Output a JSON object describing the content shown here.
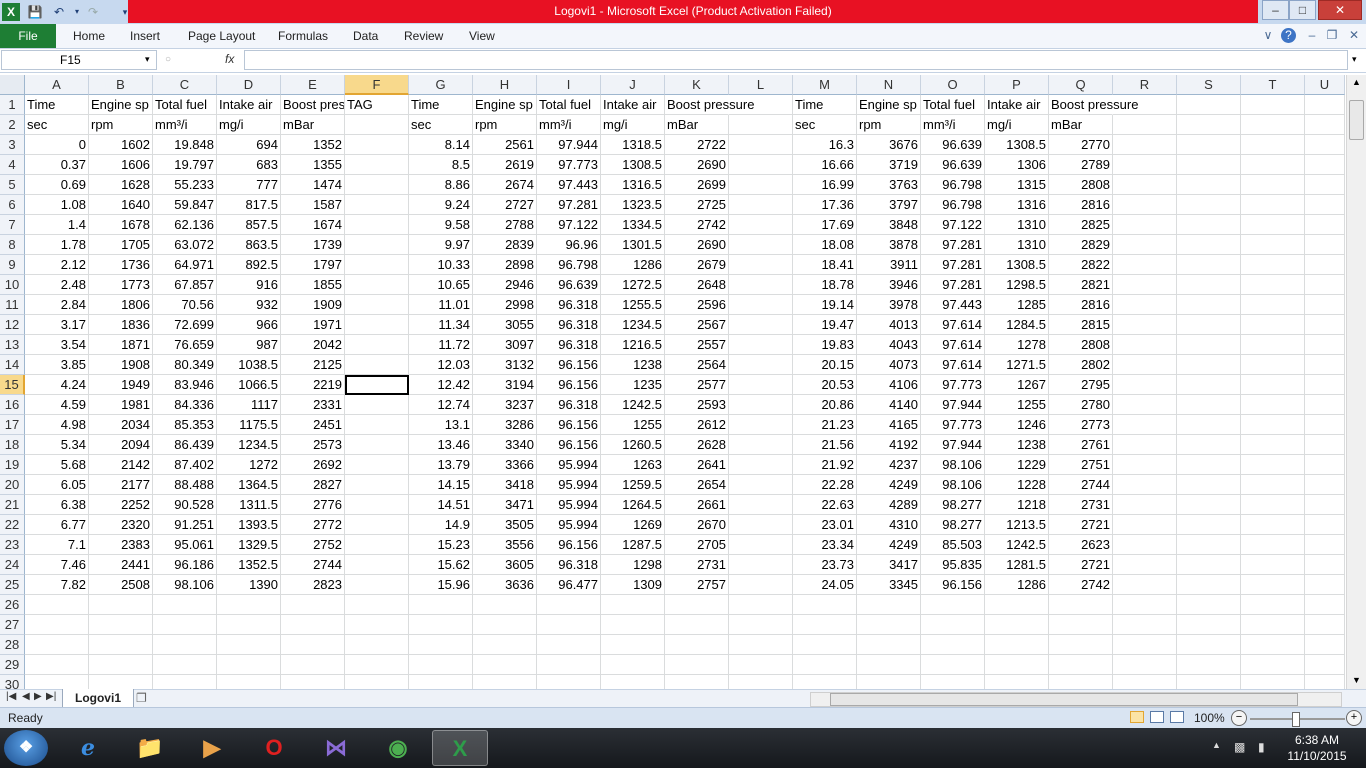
{
  "window": {
    "title": "Logovi1  -  Microsoft Excel (Product Activation Failed)",
    "minimize": "–",
    "maximize": "□",
    "close": "✕"
  },
  "ribbon": {
    "file": "File",
    "tabs": [
      "Home",
      "Insert",
      "Page Layout",
      "Formulas",
      "Data",
      "Review",
      "View"
    ]
  },
  "formula_bar": {
    "name_box": "F15",
    "fx": "fx",
    "content": ""
  },
  "grid": {
    "active_cell": "F15",
    "selected_col": "F",
    "selected_row": 15,
    "columns": [
      "A",
      "B",
      "C",
      "D",
      "E",
      "F",
      "G",
      "H",
      "I",
      "J",
      "K",
      "L",
      "M",
      "N",
      "O",
      "P",
      "Q",
      "R",
      "S",
      "T",
      "U"
    ],
    "rows": [
      [
        "Time",
        "Engine sp",
        "Total fuel",
        "Intake air",
        "Boost pres",
        "TAG",
        "Time",
        "Engine sp",
        "Total fuel",
        "Intake air",
        "Boost pressure",
        "",
        "Time",
        "Engine sp",
        "Total fuel",
        "Intake air",
        "Boost pressure",
        "",
        "",
        "",
        ""
      ],
      [
        "sec",
        "rpm",
        "mm³/i",
        "mg/i",
        "mBar",
        "",
        "sec",
        "rpm",
        "mm³/i",
        "mg/i",
        "mBar",
        "",
        "sec",
        "rpm",
        "mm³/i",
        "mg/i",
        "mBar",
        "",
        "",
        "",
        ""
      ],
      [
        "0",
        "1602",
        "19.848",
        "694",
        "1352",
        "",
        "8.14",
        "2561",
        "97.944",
        "1318.5",
        "2722",
        "",
        "16.3",
        "3676",
        "96.639",
        "1308.5",
        "2770",
        "",
        "",
        "",
        ""
      ],
      [
        "0.37",
        "1606",
        "19.797",
        "683",
        "1355",
        "",
        "8.5",
        "2619",
        "97.773",
        "1308.5",
        "2690",
        "",
        "16.66",
        "3719",
        "96.639",
        "1306",
        "2789",
        "",
        "",
        "",
        ""
      ],
      [
        "0.69",
        "1628",
        "55.233",
        "777",
        "1474",
        "",
        "8.86",
        "2674",
        "97.443",
        "1316.5",
        "2699",
        "",
        "16.99",
        "3763",
        "96.798",
        "1315",
        "2808",
        "",
        "",
        "",
        ""
      ],
      [
        "1.08",
        "1640",
        "59.847",
        "817.5",
        "1587",
        "",
        "9.24",
        "2727",
        "97.281",
        "1323.5",
        "2725",
        "",
        "17.36",
        "3797",
        "96.798",
        "1316",
        "2816",
        "",
        "",
        "",
        ""
      ],
      [
        "1.4",
        "1678",
        "62.136",
        "857.5",
        "1674",
        "",
        "9.58",
        "2788",
        "97.122",
        "1334.5",
        "2742",
        "",
        "17.69",
        "3848",
        "97.122",
        "1310",
        "2825",
        "",
        "",
        "",
        ""
      ],
      [
        "1.78",
        "1705",
        "63.072",
        "863.5",
        "1739",
        "",
        "9.97",
        "2839",
        "96.96",
        "1301.5",
        "2690",
        "",
        "18.08",
        "3878",
        "97.281",
        "1310",
        "2829",
        "",
        "",
        "",
        ""
      ],
      [
        "2.12",
        "1736",
        "64.971",
        "892.5",
        "1797",
        "",
        "10.33",
        "2898",
        "96.798",
        "1286",
        "2679",
        "",
        "18.41",
        "3911",
        "97.281",
        "1308.5",
        "2822",
        "",
        "",
        "",
        ""
      ],
      [
        "2.48",
        "1773",
        "67.857",
        "916",
        "1855",
        "",
        "10.65",
        "2946",
        "96.639",
        "1272.5",
        "2648",
        "",
        "18.78",
        "3946",
        "97.281",
        "1298.5",
        "2821",
        "",
        "",
        "",
        ""
      ],
      [
        "2.84",
        "1806",
        "70.56",
        "932",
        "1909",
        "",
        "11.01",
        "2998",
        "96.318",
        "1255.5",
        "2596",
        "",
        "19.14",
        "3978",
        "97.443",
        "1285",
        "2816",
        "",
        "",
        "",
        ""
      ],
      [
        "3.17",
        "1836",
        "72.699",
        "966",
        "1971",
        "",
        "11.34",
        "3055",
        "96.318",
        "1234.5",
        "2567",
        "",
        "19.47",
        "4013",
        "97.614",
        "1284.5",
        "2815",
        "",
        "",
        "",
        ""
      ],
      [
        "3.54",
        "1871",
        "76.659",
        "987",
        "2042",
        "",
        "11.72",
        "3097",
        "96.318",
        "1216.5",
        "2557",
        "",
        "19.83",
        "4043",
        "97.614",
        "1278",
        "2808",
        "",
        "",
        "",
        ""
      ],
      [
        "3.85",
        "1908",
        "80.349",
        "1038.5",
        "2125",
        "",
        "12.03",
        "3132",
        "96.156",
        "1238",
        "2564",
        "",
        "20.15",
        "4073",
        "97.614",
        "1271.5",
        "2802",
        "",
        "",
        "",
        ""
      ],
      [
        "4.24",
        "1949",
        "83.946",
        "1066.5",
        "2219",
        "",
        "12.42",
        "3194",
        "96.156",
        "1235",
        "2577",
        "",
        "20.53",
        "4106",
        "97.773",
        "1267",
        "2795",
        "",
        "",
        "",
        ""
      ],
      [
        "4.59",
        "1981",
        "84.336",
        "1117",
        "2331",
        "",
        "12.74",
        "3237",
        "96.318",
        "1242.5",
        "2593",
        "",
        "20.86",
        "4140",
        "97.944",
        "1255",
        "2780",
        "",
        "",
        "",
        ""
      ],
      [
        "4.98",
        "2034",
        "85.353",
        "1175.5",
        "2451",
        "",
        "13.1",
        "3286",
        "96.156",
        "1255",
        "2612",
        "",
        "21.23",
        "4165",
        "97.773",
        "1246",
        "2773",
        "",
        "",
        "",
        ""
      ],
      [
        "5.34",
        "2094",
        "86.439",
        "1234.5",
        "2573",
        "",
        "13.46",
        "3340",
        "96.156",
        "1260.5",
        "2628",
        "",
        "21.56",
        "4192",
        "97.944",
        "1238",
        "2761",
        "",
        "",
        "",
        ""
      ],
      [
        "5.68",
        "2142",
        "87.402",
        "1272",
        "2692",
        "",
        "13.79",
        "3366",
        "95.994",
        "1263",
        "2641",
        "",
        "21.92",
        "4237",
        "98.106",
        "1229",
        "2751",
        "",
        "",
        "",
        ""
      ],
      [
        "6.05",
        "2177",
        "88.488",
        "1364.5",
        "2827",
        "",
        "14.15",
        "3418",
        "95.994",
        "1259.5",
        "2654",
        "",
        "22.28",
        "4249",
        "98.106",
        "1228",
        "2744",
        "",
        "",
        "",
        ""
      ],
      [
        "6.38",
        "2252",
        "90.528",
        "1311.5",
        "2776",
        "",
        "14.51",
        "3471",
        "95.994",
        "1264.5",
        "2661",
        "",
        "22.63",
        "4289",
        "98.277",
        "1218",
        "2731",
        "",
        "",
        "",
        ""
      ],
      [
        "6.77",
        "2320",
        "91.251",
        "1393.5",
        "2772",
        "",
        "14.9",
        "3505",
        "95.994",
        "1269",
        "2670",
        "",
        "23.01",
        "4310",
        "98.277",
        "1213.5",
        "2721",
        "",
        "",
        "",
        ""
      ],
      [
        "7.1",
        "2383",
        "95.061",
        "1329.5",
        "2752",
        "",
        "15.23",
        "3556",
        "96.156",
        "1287.5",
        "2705",
        "",
        "23.34",
        "4249",
        "85.503",
        "1242.5",
        "2623",
        "",
        "",
        "",
        ""
      ],
      [
        "7.46",
        "2441",
        "96.186",
        "1352.5",
        "2744",
        "",
        "15.62",
        "3605",
        "96.318",
        "1298",
        "2731",
        "",
        "23.73",
        "3417",
        "95.835",
        "1281.5",
        "2721",
        "",
        "",
        "",
        ""
      ],
      [
        "7.82",
        "2508",
        "98.106",
        "1390",
        "2823",
        "",
        "15.96",
        "3636",
        "96.477",
        "1309",
        "2757",
        "",
        "24.05",
        "3345",
        "96.156",
        "1286",
        "2742",
        "",
        "",
        "",
        ""
      ],
      [
        "",
        "",
        "",
        "",
        "",
        "",
        "",
        "",
        "",
        "",
        "",
        "",
        "",
        "",
        "",
        "",
        "",
        "",
        "",
        "",
        ""
      ],
      [
        "",
        "",
        "",
        "",
        "",
        "",
        "",
        "",
        "",
        "",
        "",
        "",
        "",
        "",
        "",
        "",
        "",
        "",
        "",
        "",
        ""
      ],
      [
        "",
        "",
        "",
        "",
        "",
        "",
        "",
        "",
        "",
        "",
        "",
        "",
        "",
        "",
        "",
        "",
        "",
        "",
        "",
        "",
        ""
      ],
      [
        "",
        "",
        "",
        "",
        "",
        "",
        "",
        "",
        "",
        "",
        "",
        "",
        "",
        "",
        "",
        "",
        "",
        "",
        "",
        "",
        ""
      ],
      [
        "",
        "",
        "",
        "",
        "",
        "",
        "",
        "",
        "",
        "",
        "",
        "",
        "",
        "",
        "",
        "",
        "",
        "",
        "",
        "",
        ""
      ]
    ]
  },
  "sheet_tabs": [
    "Logovi1"
  ],
  "status": {
    "text": "Ready",
    "zoom": "100%"
  },
  "taskbar": {
    "time": "6:38 AM",
    "date": "11/10/2015"
  }
}
